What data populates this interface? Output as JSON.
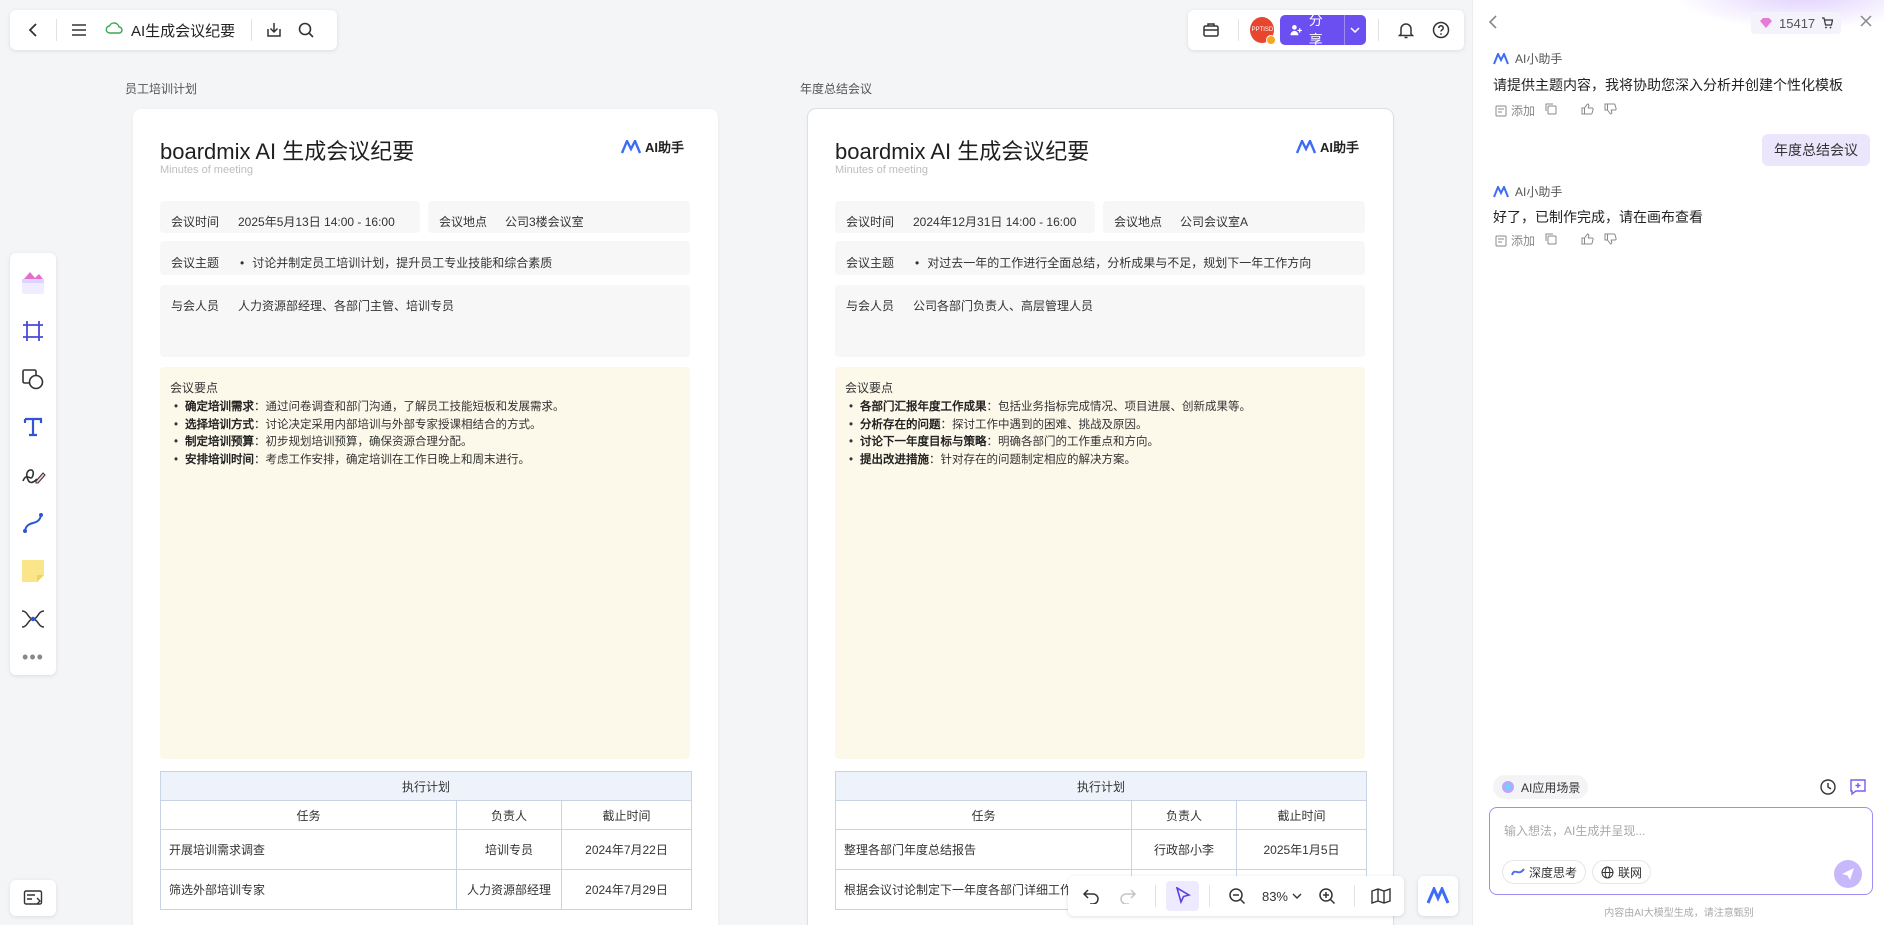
{
  "app": {
    "doc_title": "AI生成会议纪要"
  },
  "topbar": {
    "share_label": "分享",
    "avatar_text": "PPTISD"
  },
  "frames": [
    {
      "label": "员工培训计划",
      "title": "boardmix AI 生成会议纪要",
      "subtitle": "Minutes of meeting",
      "logo_text": "AI助手",
      "time_label": "会议时间",
      "time_value": "2025年5月13日 14:00 - 16:00",
      "place_label": "会议地点",
      "place_value": "公司3楼会议室",
      "topic_label": "会议主题",
      "topic_value": "讨论并制定员工培训计划，提升员工专业技能和综合素质",
      "attendees_label": "与会人员",
      "attendees_value": "人力资源部经理、各部门主管、培训专员",
      "notes_label": "会议要点",
      "notes": [
        {
          "bold": "确定培训需求",
          "text": "：通过问卷调查和部门沟通，了解员工技能短板和发展需求。"
        },
        {
          "bold": "选择培训方式",
          "text": "：讨论决定采用内部培训与外部专家授课相结合的方式。"
        },
        {
          "bold": "制定培训预算",
          "text": "：初步规划培训预算，确保资源合理分配。"
        },
        {
          "bold": "安排培训时间",
          "text": "：考虑工作安排，确定培训在工作日晚上和周末进行。"
        }
      ],
      "plan_caption": "执行计划",
      "plan_headers": [
        "任务",
        "负责人",
        "截止时间"
      ],
      "plan_rows": [
        [
          "开展培训需求调查",
          "培训专员",
          "2024年7月22日"
        ],
        [
          "筛选外部培训专家",
          "人力资源部经理",
          "2024年7月29日"
        ]
      ]
    },
    {
      "label": "年度总结会议",
      "title": "boardmix AI 生成会议纪要",
      "subtitle": "Minutes of meeting",
      "logo_text": "AI助手",
      "time_label": "会议时间",
      "time_value": "2024年12月31日 14:00 - 16:00",
      "place_label": "会议地点",
      "place_value": "公司会议室A",
      "topic_label": "会议主题",
      "topic_value": "对过去一年的工作进行全面总结，分析成果与不足，规划下一年工作方向",
      "attendees_label": "与会人员",
      "attendees_value": "公司各部门负责人、高层管理人员",
      "notes_label": "会议要点",
      "notes": [
        {
          "bold": "各部门汇报年度工作成果",
          "text": "：包括业务指标完成情况、项目进展、创新成果等。"
        },
        {
          "bold": "分析存在的问题",
          "text": "：探讨工作中遇到的困难、挑战及原因。"
        },
        {
          "bold": "讨论下一年度目标与策略",
          "text": "：明确各部门的工作重点和方向。"
        },
        {
          "bold": "提出改进措施",
          "text": "：针对存在的问题制定相应的解决方案。"
        }
      ],
      "plan_caption": "执行计划",
      "plan_headers": [
        "任务",
        "负责人",
        "截止时间"
      ],
      "plan_rows": [
        [
          "整理各部门年度总结报告",
          "行政部小李",
          "2025年1月5日"
        ],
        [
          "根据会议讨论制定下一年度各部门详细工作",
          "部",
          ""
        ]
      ]
    }
  ],
  "bottombar": {
    "zoom": "83%"
  },
  "panel": {
    "credits": "15417",
    "assistant_name": "AI小助手",
    "msg1": "请提供主题内容，我将协助您深入分析并创建个性化模板",
    "user_msg": "年度总结会议",
    "msg2": "好了，已制作完成，请在画布查看",
    "add_label": "添加",
    "scene_label": "AI应用场景",
    "input_placeholder": "输入想法，AI生成并呈现...",
    "deep_think": "深度思考",
    "web": "联网",
    "disclaimer": "内容由AI大模型生成，请注意甄别"
  },
  "colors": {
    "accent": "#6b4ff0",
    "notes_bg": "#fdf9ea",
    "table_border": "#c8d3e3",
    "user_bubble": "#ebe6fc"
  }
}
